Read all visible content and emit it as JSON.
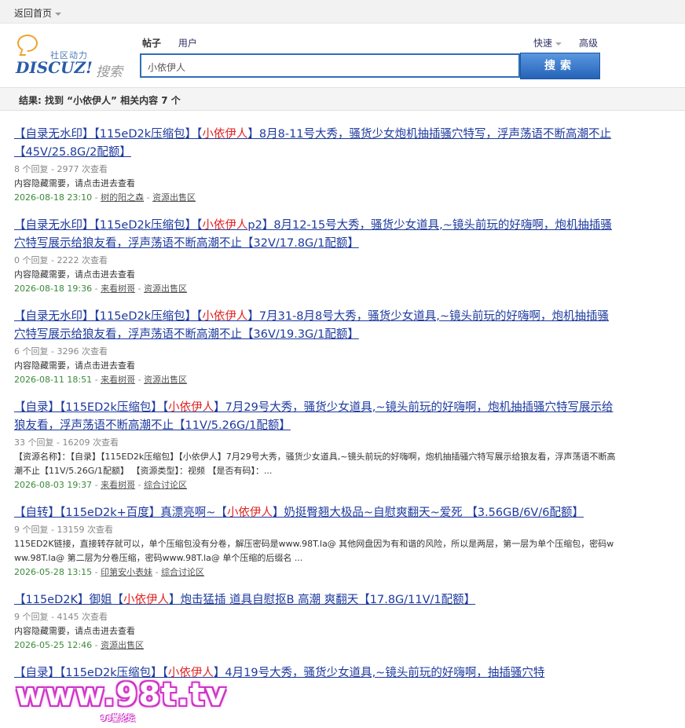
{
  "topbar": {
    "back_label": "返回首页"
  },
  "logo": {
    "community": "社区动力",
    "wordmark": "DISCUZ!",
    "sousuo": "搜索"
  },
  "tabs": [
    {
      "label": "帖子",
      "active": true
    },
    {
      "label": "用户",
      "active": false
    }
  ],
  "quick_label": "快速",
  "advanced_label": "高级",
  "search": {
    "value": "小依伊人",
    "button_label": "搜索"
  },
  "result_summary": "结果: 找到 “小依伊人” 相关内容 7 个",
  "results": [
    {
      "title_pre": "【自录无水印】【115eD2k压缩包】【",
      "keyword": "小依伊人",
      "title_post": "】8月8-11号大秀，骚货少女炮机抽插骚穴特写，浮声荡语不断高潮不止【45V/25.8G/2配额】",
      "stats": "8 个回复 - 2977 次查看",
      "snippet": "内容隐藏需要，请点击进去查看",
      "date": "2026-08-18 23:10",
      "author": "树的阳之森",
      "forum": "资源出售区"
    },
    {
      "title_pre": "【自录无水印】【115eD2k压缩包】【",
      "keyword": "小依伊人",
      "title_post": "p2】8月12-15号大秀，骚货少女道具,~镜头前玩的好嗨啊，炮机抽插骚穴特写展示给狼友看，浮声荡语不断高潮不止【32V/17.8G/1配额】",
      "stats": "0 个回复 - 2222 次查看",
      "snippet": "内容隐藏需要，请点击进去查看",
      "date": "2026-08-18 19:36",
      "author": "来看树哥",
      "forum": "资源出售区"
    },
    {
      "title_pre": "【自录无水印】【115eD2k压缩包】【",
      "keyword": "小依伊人",
      "title_post": "】7月31-8月8号大秀，骚货少女道具,~镜头前玩的好嗨啊，炮机抽插骚穴特写展示给狼友看，浮声荡语不断高潮不止【36V/19.3G/1配额】",
      "stats": "6 个回复 - 3296 次查看",
      "snippet": "内容隐藏需要，请点击进去查看",
      "date": "2026-08-11 18:51",
      "author": "来看树哥",
      "forum": "资源出售区"
    },
    {
      "title_pre": "【自录】【115ED2k压缩包】【",
      "keyword": "小依伊人",
      "title_post": "】7月29号大秀，骚货少女道具,~镜头前玩的好嗨啊，炮机抽插骚穴特写展示给狼友看，浮声荡语不断高潮不止【11V/5.26G/1配额】",
      "stats": "33 个回复 - 16209 次查看",
      "snippet": "【资源名称】：【自录】【115ED2k压缩包】【小依伊人】7月29号大秀，骚货少女道具,~镜头前玩的好嗨啊，炮机抽插骚穴特写展示给狼友看，浮声荡语不断高潮不止【11V/5.26G/1配额】 【资源类型】：视频 【是否有码】：...",
      "date": "2026-08-03 19:37",
      "author": "来看树哥",
      "forum": "综合讨论区"
    },
    {
      "title_pre": "【自转】【115eD2k+百度】真漂亮啊~【",
      "keyword": "小依伊人",
      "title_post": "】奶挺臀翘大极品~自慰爽翻天~爱死 【3.56GB/6V/6配额】",
      "stats": "9 个回复 - 13159 次查看",
      "snippet": "115ED2K链接，直接转存就可以，单个压缩包没有分卷，解压密码是www.98T.la@ 其他网盘因为有和谐的风险，所以是两层，第一层为单个压缩包，密码www.98T.la@ 第二层为分卷压缩，密码www.98T.la@ 单个压缩的后缀名 ...",
      "date": "2026-05-28 13:15",
      "author": "印第安小表妹",
      "forum": "综合讨论区"
    },
    {
      "title_pre": "【115eD2K】御姐【",
      "keyword": "小依伊人",
      "title_post": "】炮击猛插 道具自慰抠B 高潮 爽翻天【17.8G/11V/1配额】",
      "stats": "9 个回复 - 4145 次查看",
      "snippet": "内容隐藏需要，请点击进去查看",
      "date": "2026-05-25 12:46",
      "author": "",
      "forum": "资源出售区"
    },
    {
      "title_pre": "【自录】【115eD2k压缩包】【",
      "keyword": "小依伊人",
      "title_post": "】4月19号大秀，骚货少女道具,~镜头前玩的好嗨啊，抽插骚穴特",
      "stats": "",
      "snippet": "",
      "date": "",
      "author": "",
      "forum": ""
    }
  ],
  "watermark": {
    "text": "www.98t.tv",
    "sub": "98堂论坛"
  }
}
